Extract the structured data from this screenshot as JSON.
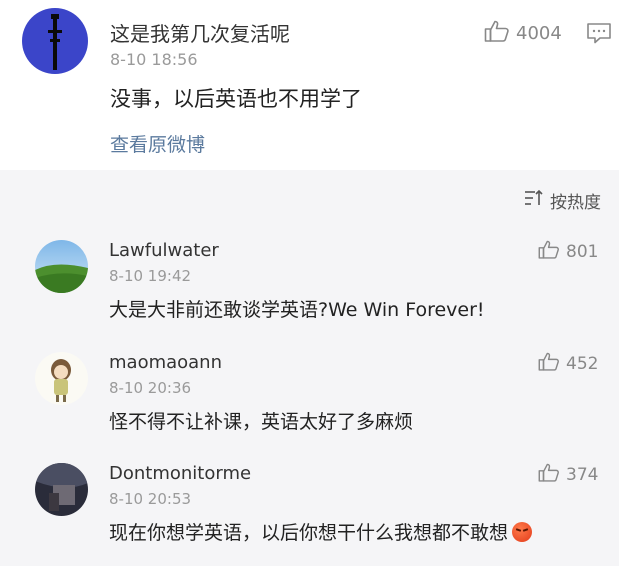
{
  "post": {
    "author": "这是我第几次复活呢",
    "time": "8-10 18:56",
    "text": "没事，以后英语也不用学了",
    "view_original": "查看原微博",
    "likes": "4004",
    "like_icon": "thumbs-up-icon",
    "comment_icon": "comment-icon",
    "avatar_colors": {
      "bg": "#3b45c9",
      "fg": "#0a0a0a"
    }
  },
  "sort": {
    "label": "按热度",
    "icon": "sort-icon"
  },
  "comments": [
    {
      "author": "Lawfulwater",
      "time": "8-10 19:42",
      "text": "大是大非前还敢谈学英语?We Win Forever!",
      "likes": "801",
      "avatar": "landscape"
    },
    {
      "author": "maomaoann",
      "time": "8-10 20:36",
      "text": "怪不得不让补课，英语太好了多麻烦",
      "likes": "452",
      "avatar": "cartoon-girl"
    },
    {
      "author": "Dontmonitorme",
      "time": "8-10 20:53",
      "text": "现在你想学英语，以后你想干什么我想都不敢想",
      "likes": "374",
      "avatar": "dark-photo",
      "emoji": "angry-face-emoji"
    }
  ]
}
